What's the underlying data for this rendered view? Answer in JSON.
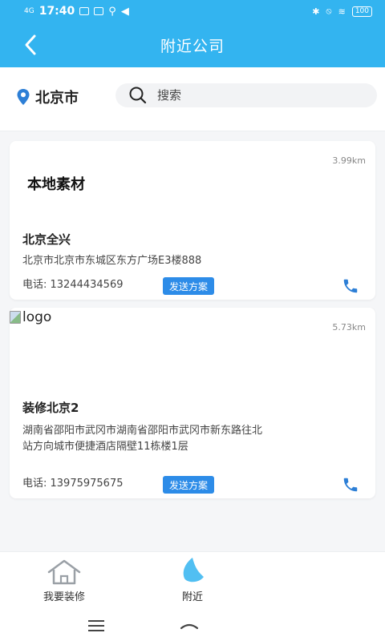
{
  "status_bar": {
    "network": "4G",
    "time": "17:40",
    "battery": "100"
  },
  "header": {
    "title": "附近公司"
  },
  "search": {
    "city": "北京市",
    "placeholder": "搜索"
  },
  "companies": [
    {
      "logo_text": "本地素材",
      "distance": "3.99km",
      "name": "北京全兴",
      "address": "北京市北京市东城区东方广场E3楼888",
      "phone": "电话: 13244434569",
      "action_label": "发送方案"
    },
    {
      "logo_text": "logo",
      "distance": "5.73km",
      "name": "装修北京2",
      "address": "湖南省邵阳市武冈市湖南省邵阳市武冈市新东路往北站方向城市便捷酒店隔壁11栋楼1层",
      "phone": "电话: 13975975675",
      "action_label": "发送方案"
    }
  ],
  "bottom_nav": {
    "items": [
      {
        "label": "我要装修",
        "icon": "home-icon"
      },
      {
        "label": "附近",
        "icon": "location-icon"
      }
    ]
  },
  "colors": {
    "primary": "#33b4f0",
    "button": "#2d8ce8",
    "phone_icon": "#2d7fd6"
  }
}
